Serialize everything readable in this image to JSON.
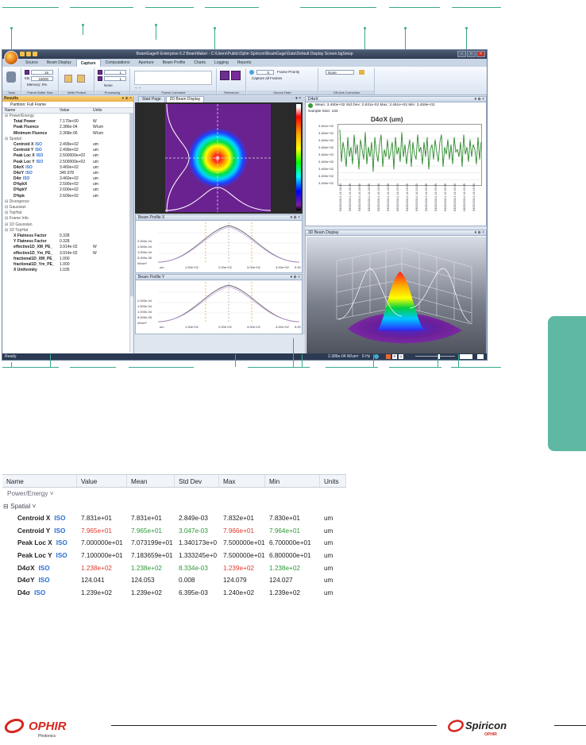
{
  "window": {
    "title": "BeamGage® Enterprise 6.2 BeamMaker - C:\\Users\\Public\\Ophir-Spiricon\\BeamGage\\Data\\Default Display Screen.bgSetup"
  },
  "ribbon_tabs": [
    "Source",
    "Beam Display",
    "Capture",
    "Computations",
    "Aperture",
    "Beam Profile",
    "Charts",
    "Logging",
    "Reports"
  ],
  "active_tab": "Capture",
  "ribbon": {
    "frames_value": "16",
    "kb_label": "KB",
    "kb_value": "16000",
    "memory_label": "Memory: 0%",
    "x_value": "1",
    "y_value": "1",
    "processing_value": "None",
    "frame_priority": "Frame Priority",
    "capture_all_frames": "Capture all Frames",
    "source_rate_value": "0",
    "offaxis_value": "None",
    "groups": [
      "Tools",
      "Frame Buffer Size",
      "Write Protect",
      "Processing",
      "Frame Comment",
      "Reference",
      "Source Rate",
      "Off-Axis Correction"
    ]
  },
  "results": {
    "title": "Results",
    "partition_label": "Partition:",
    "partition_value": "Full Frame",
    "columns": [
      "Name",
      "Value",
      "Units"
    ],
    "rows": [
      {
        "name": "Power/Energy",
        "value": "",
        "units": "",
        "kind": "group"
      },
      {
        "name": "Total Power",
        "value": "7.170e+00",
        "units": "W",
        "kind": "item"
      },
      {
        "name": "Peak Fluence",
        "value": "2.386e-04",
        "units": "W/um",
        "kind": "item"
      },
      {
        "name": "Minimum Fluence",
        "value": "2.368e-06",
        "units": "W/um",
        "kind": "item"
      },
      {
        "name": "Spatial",
        "value": "",
        "units": "",
        "kind": "group"
      },
      {
        "name": "Centroid X",
        "value": "2.499e+02",
        "units": "um",
        "kind": "iso"
      },
      {
        "name": "Centroid Y",
        "value": "2.499e+02",
        "units": "um",
        "kind": "iso"
      },
      {
        "name": "Peak Loc X",
        "value": "2.500000e+02",
        "units": "um",
        "kind": "iso"
      },
      {
        "name": "Peak Loc Y",
        "value": "2.500000e+02",
        "units": "um",
        "kind": "iso"
      },
      {
        "name": "D4σX",
        "value": "3.460e+02",
        "units": "um",
        "kind": "iso"
      },
      {
        "name": "D4σY",
        "value": "345.978",
        "units": "um",
        "kind": "iso"
      },
      {
        "name": "D4σ",
        "value": "3.460e+02",
        "units": "um",
        "kind": "iso"
      },
      {
        "name": "D%pkX",
        "value": "2.590e+02",
        "units": "um",
        "kind": "item"
      },
      {
        "name": "D%pkY",
        "value": "2.600e+02",
        "units": "um",
        "kind": "item"
      },
      {
        "name": "D%pk",
        "value": "2.609e+02",
        "units": "um",
        "kind": "item"
      },
      {
        "name": "Divergence",
        "value": "",
        "units": "",
        "kind": "group"
      },
      {
        "name": "Gaussian",
        "value": "",
        "units": "",
        "kind": "group"
      },
      {
        "name": "TopHat",
        "value": "",
        "units": "",
        "kind": "group"
      },
      {
        "name": "Frame Info",
        "value": "",
        "units": "",
        "kind": "group"
      },
      {
        "name": "1D Gaussian",
        "value": "",
        "units": "",
        "kind": "group"
      },
      {
        "name": "1D TopHat",
        "value": "",
        "units": "",
        "kind": "group"
      },
      {
        "name": "X Flatness Factor",
        "value": "0.328",
        "units": "",
        "kind": "item"
      },
      {
        "name": "Y Flatness Factor",
        "value": "0.328",
        "units": "",
        "kind": "item"
      },
      {
        "name": "effective1D_XM_PE_",
        "value": "3.914e-02",
        "units": "W",
        "kind": "item"
      },
      {
        "name": "effective1D_Ym_PE_",
        "value": "3.914e-02",
        "units": "W",
        "kind": "item"
      },
      {
        "name": "fractional1D_XM_PE_",
        "value": "1.000",
        "units": "",
        "kind": "item"
      },
      {
        "name": "fractional1D_Ym_PE_",
        "value": "1.000",
        "units": "",
        "kind": "item"
      },
      {
        "name": "X Uniformity",
        "value": "1.035",
        "units": "",
        "kind": "item"
      }
    ]
  },
  "doc_tabs": [
    "Start Page",
    "2D Beam Display"
  ],
  "profile_x": {
    "title": "Beam Profile X",
    "y_ticks": [
      "2.000e-04",
      "1.500e-04",
      "1.000e-04",
      "5.000e-05",
      "W/um²"
    ],
    "x_ticks": [
      "um",
      "1.00e+02",
      "2.00e+02",
      "3.00e+02",
      "4.00e+02",
      "5.00"
    ]
  },
  "profile_y": {
    "title": "Beam Profile Y",
    "y_ticks": [
      "2.000e-04",
      "1.500e-04",
      "1.000e-04",
      "5.000e-05",
      "W/um²"
    ],
    "x_ticks": [
      "um",
      "1.00e+02",
      "2.00e+02",
      "3.00e+02",
      "4.00e+02",
      "5.00"
    ]
  },
  "d4panel": {
    "title": "D4σX",
    "stats": "Mean: 3.460e+02   Std Dev: 2.931e-02   Max: 3.461e+02   Min: 3.459e+02",
    "sample_size": "Sample Size: 132",
    "chart_title": "D4σX (um)"
  },
  "chart_data": {
    "type": "line",
    "title": "D4σX (um)",
    "ylabel": "",
    "xlabel": "",
    "ylim": [
      345.85,
      346.1
    ],
    "y_ticks": [
      "3.461e+02",
      "3.460e+02",
      "3.460e+02",
      "3.460e+02",
      "3.460e+02",
      "3.460e+02",
      "3.460e+02",
      "3.459e+02",
      "3.459e+02"
    ],
    "x_ticks": [
      "03/02/2014 14:18:40",
      "03/02/2014 14:18:45",
      "03/02/2014 14:18:50",
      "03/02/2014 14:18:55",
      "03/02/2014 14:19:00",
      "03/02/2014 14:19:05",
      "03/02/2014 14:19:10",
      "03/02/2014 14:19:15",
      "03/02/2014 14:19:20",
      "03/02/2014 14:19:25",
      "03/02/2014 14:19:30",
      "03/02/2014 14:19:35",
      "03/02/2014 14:19:40",
      "03/02/2014 14:19:45",
      "03/02/2014 14:19:50"
    ],
    "series": [
      {
        "color": "#2e8b2e",
        "values": [
          346.08,
          345.95,
          346.03,
          345.99,
          345.93,
          346.05,
          345.97,
          346.01,
          345.94,
          346.06,
          345.98,
          346.02,
          345.92,
          346.04,
          346.0,
          345.96,
          346.07,
          345.94,
          346.01,
          345.97,
          346.03,
          345.91,
          346.05,
          345.99,
          345.95,
          346.02,
          346.06,
          345.93,
          346.0,
          345.97,
          346.04,
          345.96,
          345.99,
          346.03,
          345.92,
          346.05,
          345.98,
          346.01,
          345.95,
          346.07,
          345.97,
          346.02,
          345.94,
          346.0,
          346.04,
          345.93,
          346.03,
          345.98,
          345.96,
          346.06,
          345.99,
          346.01,
          345.94,
          346.03,
          345.97,
          346.05,
          345.92,
          346.0,
          346.02,
          345.96,
          346.04,
          345.99,
          345.95,
          346.03,
          346.06,
          345.93,
          346.01,
          345.98,
          346.04,
          345.96,
          346.02,
          345.94,
          346.05,
          345.99,
          346.0,
          345.97,
          346.03,
          345.93,
          346.06,
          345.98,
          346.01,
          345.95,
          346.04,
          345.97,
          346.02,
          346.0,
          345.94,
          346.05,
          345.96,
          346.03
        ]
      }
    ]
  },
  "panel3d": {
    "title": "3D Beam Display"
  },
  "statusbar": {
    "left": "Ready",
    "fluence": "2.386e-04 W/um²",
    "rate": "6 Hz"
  },
  "big_table": {
    "columns": [
      "Name",
      "Value",
      "Mean",
      "Std Dev",
      "Max",
      "Min",
      "Units"
    ],
    "groups": [
      "Power/Energy",
      "Spatial"
    ],
    "rows": [
      {
        "name": "Centroid X",
        "value": "7.831e+01",
        "mean": "7.831e+01",
        "std": "2.849e-03",
        "max": "7.832e+01",
        "min": "7.830e+01",
        "units": "um",
        "style": "normal"
      },
      {
        "name": "Centroid Y",
        "value": "7.965e+01",
        "mean": "7.965e+01",
        "std": "3.047e-03",
        "max": "7.966e+01",
        "min": "7.964e+01",
        "units": "um",
        "style": "colored"
      },
      {
        "name": "Peak Loc X",
        "value": "7.000000e+01",
        "mean": "7.073199e+01",
        "std": "1.340173e+0",
        "max": "7.500000e+01",
        "min": "6.700000e+01",
        "units": "um",
        "style": "normal"
      },
      {
        "name": "Peak Loc Y",
        "value": "7.100000e+01",
        "mean": "7.183659e+01",
        "std": "1.333245e+0",
        "max": "7.500000e+01",
        "min": "6.800000e+01",
        "units": "um",
        "style": "normal"
      },
      {
        "name": "D4σX",
        "value": "1.238e+02",
        "mean": "1.238e+02",
        "std": "8.334e-03",
        "max": "1.239e+02",
        "min": "1.238e+02",
        "units": "um",
        "style": "colored"
      },
      {
        "name": "D4σY",
        "value": "124.041",
        "mean": "124.053",
        "std": "0.008",
        "max": "124.079",
        "min": "124.027",
        "units": "um",
        "style": "normal"
      },
      {
        "name": "D4σ",
        "value": "1.239e+02",
        "mean": "1.239e+02",
        "std": "6.395e-03",
        "max": "1.240e+02",
        "min": "1.239e+02",
        "units": "um",
        "style": "normal"
      }
    ],
    "iso_label": "ISO"
  },
  "footer": {
    "ophir_logo": "OPHIR Photonics",
    "spiricon_logo": "Spiricon OPHIR Photonics"
  }
}
